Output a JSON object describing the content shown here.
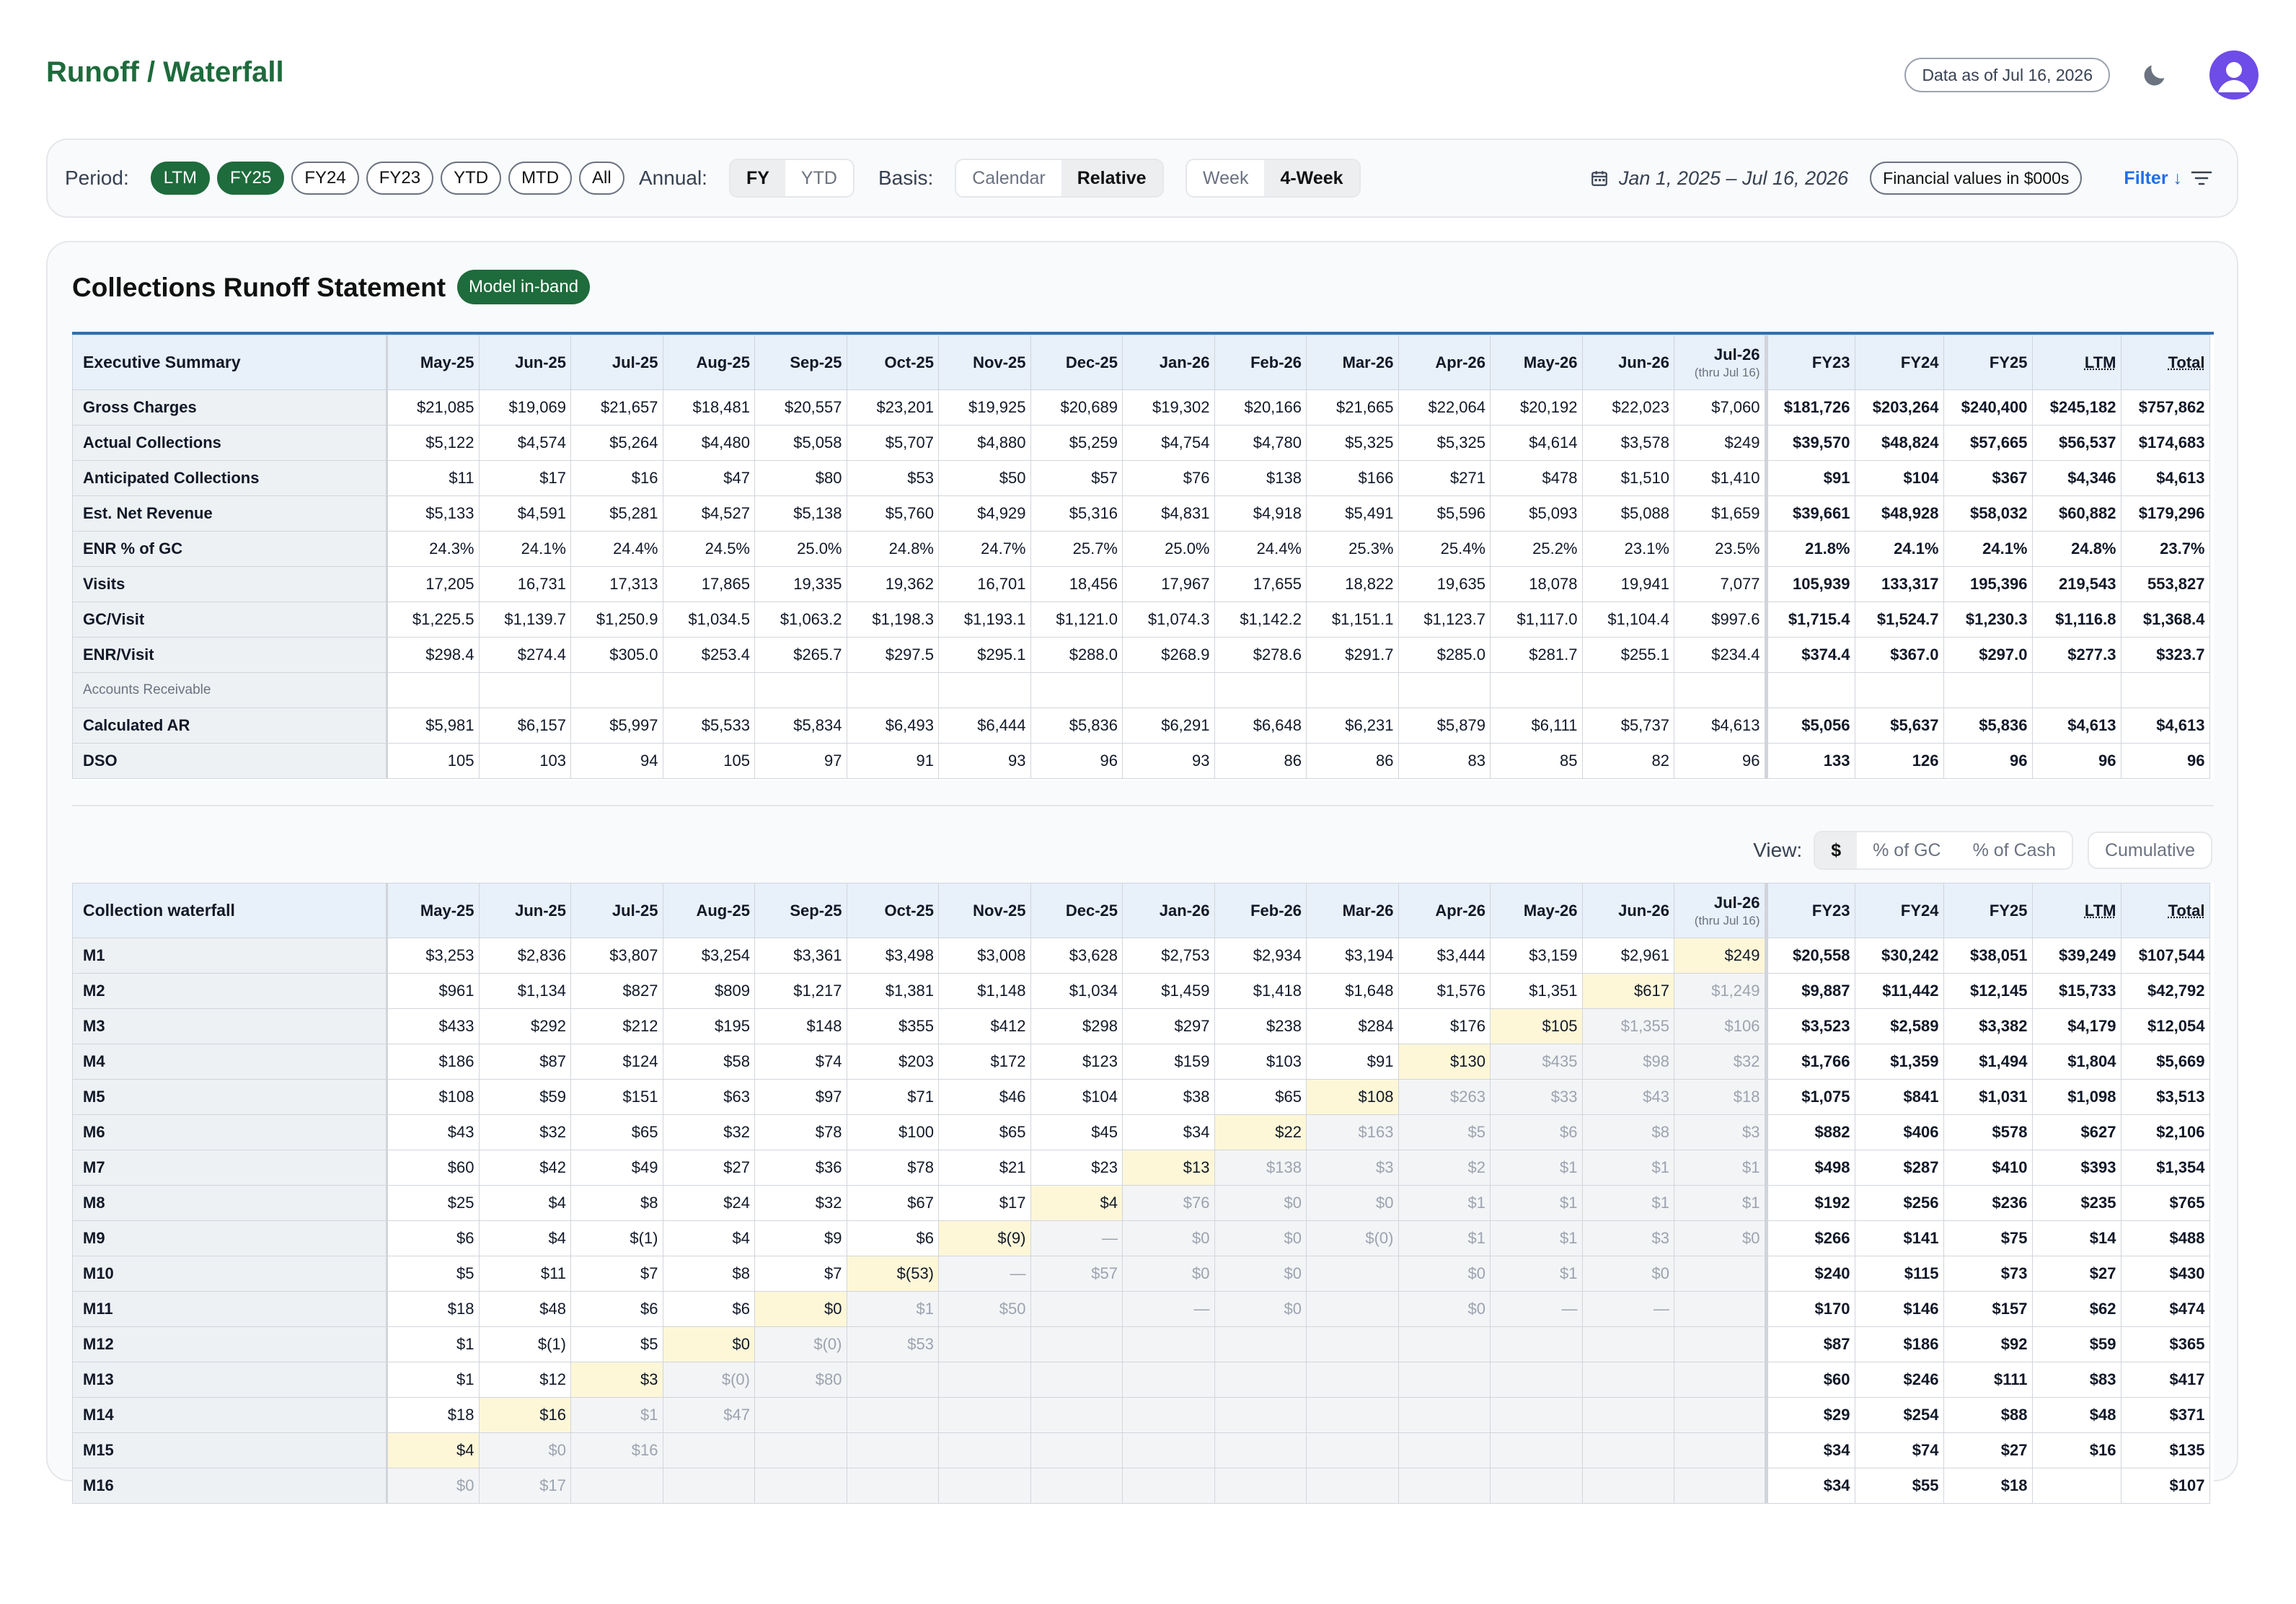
{
  "header": {
    "title": "Runoff / Waterfall",
    "as_of": "Data as of Jul 16, 2026"
  },
  "filters": {
    "period_label": "Period:",
    "periods": [
      {
        "label": "LTM",
        "active": true
      },
      {
        "label": "FY25",
        "active": true
      },
      {
        "label": "FY24",
        "active": false
      },
      {
        "label": "FY23",
        "active": false
      },
      {
        "label": "YTD",
        "active": false
      },
      {
        "label": "MTD",
        "active": false
      },
      {
        "label": "All",
        "active": false
      }
    ],
    "annual_label": "Annual:",
    "annual": [
      {
        "label": "FY",
        "active": true
      },
      {
        "label": "YTD",
        "active": false
      }
    ],
    "basis_label": "Basis:",
    "basis": [
      {
        "label": "Calendar",
        "active": false
      },
      {
        "label": "Relative",
        "active": true
      }
    ],
    "granularity": [
      {
        "label": "Week",
        "active": false
      },
      {
        "label": "4-Week",
        "active": true
      }
    ],
    "date_range": "Jan 1, 2025 – Jul 16, 2026",
    "financial_units": "Financial values in $000s",
    "filter_label": "Filter ↓"
  },
  "statement": {
    "title": "Collections Runoff Statement",
    "badge": "Model in-band",
    "columns": [
      "May-25",
      "Jun-25",
      "Jul-25",
      "Aug-25",
      "Sep-25",
      "Oct-25",
      "Nov-25",
      "Dec-25",
      "Jan-26",
      "Feb-26",
      "Mar-26",
      "Apr-26",
      "May-26",
      "Jun-26",
      "Jul-26"
    ],
    "last_col_note": "(thru Jul 16)",
    "totals_columns": [
      "FY23",
      "FY24",
      "FY25",
      "LTM",
      "Total"
    ],
    "summary_header": "Executive Summary",
    "rows": [
      {
        "label": "Gross Charges",
        "values": [
          "$21,085",
          "$19,069",
          "$21,657",
          "$18,481",
          "$20,557",
          "$23,201",
          "$19,925",
          "$20,689",
          "$19,302",
          "$20,166",
          "$21,665",
          "$22,064",
          "$20,192",
          "$22,023",
          "$7,060"
        ],
        "totals": [
          "$181,726",
          "$203,264",
          "$240,400",
          "$245,182",
          "$757,862"
        ]
      },
      {
        "label": "Actual Collections",
        "values": [
          "$5,122",
          "$4,574",
          "$5,264",
          "$4,480",
          "$5,058",
          "$5,707",
          "$4,880",
          "$5,259",
          "$4,754",
          "$4,780",
          "$5,325",
          "$5,325",
          "$4,614",
          "$3,578",
          "$249"
        ],
        "totals": [
          "$39,570",
          "$48,824",
          "$57,665",
          "$56,537",
          "$174,683"
        ]
      },
      {
        "label": "Anticipated Collections",
        "values": [
          "$11",
          "$17",
          "$16",
          "$47",
          "$80",
          "$53",
          "$50",
          "$57",
          "$76",
          "$138",
          "$166",
          "$271",
          "$478",
          "$1,510",
          "$1,410"
        ],
        "totals": [
          "$91",
          "$104",
          "$367",
          "$4,346",
          "$4,613"
        ]
      },
      {
        "label": "Est. Net Revenue",
        "values": [
          "$5,133",
          "$4,591",
          "$5,281",
          "$4,527",
          "$5,138",
          "$5,760",
          "$4,929",
          "$5,316",
          "$4,831",
          "$4,918",
          "$5,491",
          "$5,596",
          "$5,093",
          "$5,088",
          "$1,659"
        ],
        "totals": [
          "$39,661",
          "$48,928",
          "$58,032",
          "$60,882",
          "$179,296"
        ]
      },
      {
        "label": "ENR % of GC",
        "values": [
          "24.3%",
          "24.1%",
          "24.4%",
          "24.5%",
          "25.0%",
          "24.8%",
          "24.7%",
          "25.7%",
          "25.0%",
          "24.4%",
          "25.3%",
          "25.4%",
          "25.2%",
          "23.1%",
          "23.5%"
        ],
        "totals": [
          "21.8%",
          "24.1%",
          "24.1%",
          "24.8%",
          "23.7%"
        ]
      },
      {
        "label": "Visits",
        "values": [
          "17,205",
          "16,731",
          "17,313",
          "17,865",
          "19,335",
          "19,362",
          "16,701",
          "18,456",
          "17,967",
          "17,655",
          "18,822",
          "19,635",
          "18,078",
          "19,941",
          "7,077"
        ],
        "totals": [
          "105,939",
          "133,317",
          "195,396",
          "219,543",
          "553,827"
        ]
      },
      {
        "label": "GC/Visit",
        "values": [
          "$1,225.5",
          "$1,139.7",
          "$1,250.9",
          "$1,034.5",
          "$1,063.2",
          "$1,198.3",
          "$1,193.1",
          "$1,121.0",
          "$1,074.3",
          "$1,142.2",
          "$1,151.1",
          "$1,123.7",
          "$1,117.0",
          "$1,104.4",
          "$997.6"
        ],
        "totals": [
          "$1,715.4",
          "$1,524.7",
          "$1,230.3",
          "$1,116.8",
          "$1,368.4"
        ]
      },
      {
        "label": "ENR/Visit",
        "values": [
          "$298.4",
          "$274.4",
          "$305.0",
          "$253.4",
          "$265.7",
          "$297.5",
          "$295.1",
          "$288.0",
          "$268.9",
          "$278.6",
          "$291.7",
          "$285.0",
          "$281.7",
          "$255.1",
          "$234.4"
        ],
        "totals": [
          "$374.4",
          "$367.0",
          "$297.0",
          "$277.3",
          "$323.7"
        ]
      },
      {
        "label": "Accounts Receivable",
        "section": true,
        "values": [
          "",
          "",
          "",
          "",
          "",
          "",
          "",
          "",
          "",
          "",
          "",
          "",
          "",
          "",
          ""
        ],
        "totals": [
          "",
          "",
          "",
          "",
          ""
        ]
      },
      {
        "label": "Calculated AR",
        "values": [
          "$5,981",
          "$6,157",
          "$5,997",
          "$5,533",
          "$5,834",
          "$6,493",
          "$6,444",
          "$5,836",
          "$6,291",
          "$6,648",
          "$6,231",
          "$5,879",
          "$6,111",
          "$5,737",
          "$4,613"
        ],
        "totals": [
          "$5,056",
          "$5,637",
          "$5,836",
          "$4,613",
          "$4,613"
        ]
      },
      {
        "label": "DSO",
        "values": [
          "105",
          "103",
          "94",
          "105",
          "97",
          "91",
          "93",
          "96",
          "93",
          "86",
          "86",
          "83",
          "85",
          "82",
          "96"
        ],
        "totals": [
          "133",
          "126",
          "96",
          "96",
          "96"
        ]
      }
    ]
  },
  "view": {
    "label": "View:",
    "options": [
      {
        "label": "$",
        "active": true
      },
      {
        "label": "% of GC",
        "active": false
      },
      {
        "label": "% of Cash",
        "active": false
      }
    ],
    "cumulative": "Cumulative"
  },
  "waterfall": {
    "header": "Collection waterfall",
    "rows": [
      {
        "label": "M1",
        "values": [
          "$3,253",
          "$2,836",
          "$3,807",
          "$3,254",
          "$3,361",
          "$3,498",
          "$3,008",
          "$3,628",
          "$2,753",
          "$2,934",
          "$3,194",
          "$3,444",
          "$3,159",
          "$2,961",
          "$249"
        ],
        "totals": [
          "$20,558",
          "$30,242",
          "$38,051",
          "$39,249",
          "$107,544"
        ]
      },
      {
        "label": "M2",
        "values": [
          "$961",
          "$1,134",
          "$827",
          "$809",
          "$1,217",
          "$1,381",
          "$1,148",
          "$1,034",
          "$1,459",
          "$1,418",
          "$1,648",
          "$1,576",
          "$1,351",
          "$617",
          "$1,249"
        ],
        "totals": [
          "$9,887",
          "$11,442",
          "$12,145",
          "$15,733",
          "$42,792"
        ]
      },
      {
        "label": "M3",
        "values": [
          "$433",
          "$292",
          "$212",
          "$195",
          "$148",
          "$355",
          "$412",
          "$298",
          "$297",
          "$238",
          "$284",
          "$176",
          "$105",
          "$1,355",
          "$106"
        ],
        "totals": [
          "$3,523",
          "$2,589",
          "$3,382",
          "$4,179",
          "$12,054"
        ]
      },
      {
        "label": "M4",
        "values": [
          "$186",
          "$87",
          "$124",
          "$58",
          "$74",
          "$203",
          "$172",
          "$123",
          "$159",
          "$103",
          "$91",
          "$130",
          "$435",
          "$98",
          "$32"
        ],
        "totals": [
          "$1,766",
          "$1,359",
          "$1,494",
          "$1,804",
          "$5,669"
        ]
      },
      {
        "label": "M5",
        "values": [
          "$108",
          "$59",
          "$151",
          "$63",
          "$97",
          "$71",
          "$46",
          "$104",
          "$38",
          "$65",
          "$108",
          "$263",
          "$33",
          "$43",
          "$18"
        ],
        "totals": [
          "$1,075",
          "$841",
          "$1,031",
          "$1,098",
          "$3,513"
        ]
      },
      {
        "label": "M6",
        "values": [
          "$43",
          "$32",
          "$65",
          "$32",
          "$78",
          "$100",
          "$65",
          "$45",
          "$34",
          "$22",
          "$163",
          "$5",
          "$6",
          "$8",
          "$3"
        ],
        "totals": [
          "$882",
          "$406",
          "$578",
          "$627",
          "$2,106"
        ]
      },
      {
        "label": "M7",
        "values": [
          "$60",
          "$42",
          "$49",
          "$27",
          "$36",
          "$78",
          "$21",
          "$23",
          "$13",
          "$138",
          "$3",
          "$2",
          "$1",
          "$1",
          "$1"
        ],
        "totals": [
          "$498",
          "$287",
          "$410",
          "$393",
          "$1,354"
        ]
      },
      {
        "label": "M8",
        "values": [
          "$25",
          "$4",
          "$8",
          "$24",
          "$32",
          "$67",
          "$17",
          "$4",
          "$76",
          "$0",
          "$0",
          "$1",
          "$1",
          "$1",
          "$1"
        ],
        "totals": [
          "$192",
          "$256",
          "$236",
          "$235",
          "$765"
        ]
      },
      {
        "label": "M9",
        "values": [
          "$6",
          "$4",
          "$(1)",
          "$4",
          "$9",
          "$6",
          "$(9)",
          "—",
          "$0",
          "$0",
          "$(0)",
          "$1",
          "$1",
          "$3",
          "$0"
        ],
        "totals": [
          "$266",
          "$141",
          "$75",
          "$14",
          "$488"
        ]
      },
      {
        "label": "M10",
        "values": [
          "$5",
          "$11",
          "$7",
          "$8",
          "$7",
          "$(53)",
          "—",
          "$57",
          "$0",
          "$0",
          "",
          "$0",
          "$1",
          "$0",
          ""
        ],
        "totals": [
          "$240",
          "$115",
          "$73",
          "$27",
          "$430"
        ]
      },
      {
        "label": "M11",
        "values": [
          "$18",
          "$48",
          "$6",
          "$6",
          "$0",
          "$1",
          "$50",
          "",
          "—",
          "$0",
          "",
          "$0",
          "—",
          "—",
          ""
        ],
        "totals": [
          "$170",
          "$146",
          "$157",
          "$62",
          "$474"
        ]
      },
      {
        "label": "M12",
        "values": [
          "$1",
          "$(1)",
          "$5",
          "$0",
          "$(0)",
          "$53",
          "",
          "",
          "",
          "",
          "",
          "",
          "",
          "",
          ""
        ],
        "totals": [
          "$87",
          "$186",
          "$92",
          "$59",
          "$365"
        ]
      },
      {
        "label": "M13",
        "values": [
          "$1",
          "$12",
          "$3",
          "$(0)",
          "$80",
          "",
          "",
          "",
          "",
          "",
          "",
          "",
          "",
          "",
          ""
        ],
        "totals": [
          "$60",
          "$246",
          "$111",
          "$83",
          "$417"
        ]
      },
      {
        "label": "M14",
        "values": [
          "$18",
          "$16",
          "$1",
          "$47",
          "",
          "",
          "",
          "",
          "",
          "",
          "",
          "",
          "",
          "",
          ""
        ],
        "totals": [
          "$29",
          "$254",
          "$88",
          "$48",
          "$371"
        ]
      },
      {
        "label": "M15",
        "values": [
          "$4",
          "$0",
          "$16",
          "",
          "",
          "",
          "",
          "",
          "",
          "",
          "",
          "",
          "",
          "",
          ""
        ],
        "totals": [
          "$34",
          "$74",
          "$27",
          "$16",
          "$135"
        ]
      },
      {
        "label": "M16",
        "values": [
          "$0",
          "$17",
          "",
          "",
          "",
          "",
          "",
          "",
          "",
          "",
          "",
          "",
          "",
          "",
          ""
        ],
        "totals": [
          "$34",
          "$55",
          "$18",
          "",
          "$107"
        ]
      }
    ]
  }
}
